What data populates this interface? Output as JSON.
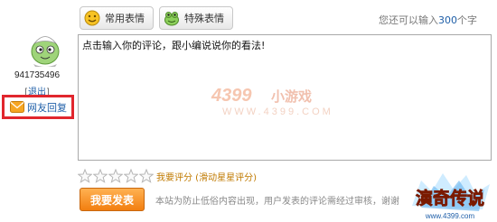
{
  "user": {
    "id": "941735496",
    "logout_label": "退出",
    "reply_label": "网友回复"
  },
  "toolbar": {
    "common_emoji_label": "常用表情",
    "special_emoji_label": "特殊表情"
  },
  "counter": {
    "prefix": "您还可以输入",
    "count": "300",
    "suffix": "个字"
  },
  "comment": {
    "placeholder": "点击输入你的评论，跟小编说说你的看法!"
  },
  "watermark": {
    "brand": "4399",
    "brand_cn": "小游戏",
    "url": "WWW.4399.COM"
  },
  "rating": {
    "stars_total": 5,
    "stars_selected": 0,
    "label": "我要评分 (滑动星星评分)"
  },
  "submit": {
    "label": "我要发表"
  },
  "notice": {
    "text": "本站为防止低俗内容出现，用户发表的评论需经过审核，谢谢"
  },
  "logo": {
    "title": "演奇传说",
    "url": "www.4399.com"
  },
  "colors": {
    "highlight": "#e1262d",
    "submit_bg": "#f27f10",
    "link": "#1f5fa8",
    "rating_text": "#c07a00"
  }
}
